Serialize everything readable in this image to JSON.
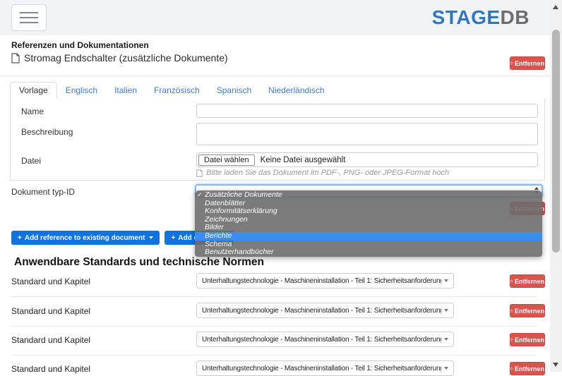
{
  "header": {
    "logo": {
      "primary": "STAGE",
      "secondary": "DB"
    }
  },
  "documents": {
    "section_title": "Referenzen und Dokumentationen",
    "item_title": "Stromag Endschalter (zusätzliche Dokumente)",
    "remove_label": "Entfernen"
  },
  "tabs": {
    "active": "Vorlage",
    "items": [
      {
        "label": "Vorlage"
      },
      {
        "label": "Englisch"
      },
      {
        "label": "Italien"
      },
      {
        "label": "Französisch"
      },
      {
        "label": "Spanisch"
      },
      {
        "label": "Niederländisch"
      }
    ]
  },
  "form": {
    "name": {
      "label": "Name",
      "value": "",
      "placeholder": ""
    },
    "description": {
      "label": "Beschreibung",
      "value": ""
    },
    "file": {
      "label": "Datei",
      "button": "Datei wählen",
      "status": "Keine Datei ausgewählt",
      "hint": "Bitte laden Sie das Dokument im PDF-, PNG- oder JPEG-Format hoch"
    },
    "doctype": {
      "label": "Dokument typ-ID",
      "selected": "Zusätzliche Dokumente",
      "remove_label": "Entfernen"
    }
  },
  "doctype_dropdown": {
    "check_glyph": "✓",
    "highlighted_option": "Berichte",
    "options": [
      {
        "label": "Zusätzliche Dokumente",
        "selected": true,
        "highlighted": false
      },
      {
        "label": "Datenblätter",
        "selected": false,
        "highlighted": false
      },
      {
        "label": "Konformitätserklärung",
        "selected": false,
        "highlighted": false
      },
      {
        "label": "Zeichnungen",
        "selected": false,
        "highlighted": false
      },
      {
        "label": "Bilder",
        "selected": false,
        "highlighted": false
      },
      {
        "label": "Berichte",
        "selected": false,
        "highlighted": true
      },
      {
        "label": "Schema",
        "selected": false,
        "highlighted": false
      },
      {
        "label": "Benutzerhandbücher",
        "selected": false,
        "highlighted": false
      }
    ]
  },
  "actions": {
    "plus_glyph": "+",
    "add_reference_label": "Add reference to existing document",
    "add_document_label": "Add document"
  },
  "standards": {
    "section_title": "Anwendbare Standards und technische Normen",
    "rows": [
      {
        "label": "Standard und Kapitel",
        "value": "Unterhaltungstechnologie - Maschineninstallation - Teil 1: Sicherheitsanforderungen…",
        "remove_label": "Entfernen"
      },
      {
        "label": "Standard und Kapitel",
        "value": "Unterhaltungstechnologie - Maschineninstallation - Teil 1: Sicherheitsanforderungen…",
        "remove_label": "Entfernen"
      },
      {
        "label": "Standard und Kapitel",
        "value": "Unterhaltungstechnologie - Maschineninstallation - Teil 1: Sicherheitsanforderungen…",
        "remove_label": "Entfernen"
      },
      {
        "label": "Standard und Kapitel",
        "value": "Unterhaltungstechnologie - Maschineninstallation - Teil 1: Sicherheitsanforderungen…",
        "remove_label": "Entfernen"
      }
    ]
  },
  "icons": {
    "menu": "hamburger-icon",
    "remove": "trash-icon",
    "document": "document-icon",
    "dropdown_caret": "chevron-down-icon",
    "selected_mark": "check-icon"
  },
  "colors": {
    "accent_blue": "#1273dd",
    "danger_red": "#d9534f",
    "logo_blue": "#3077c2",
    "logo_gray": "#6e6e6e",
    "dropdown_highlight": "#3c8cf3",
    "focus_ring": "#8ab8ef",
    "header_bg": "#f2f3f5"
  }
}
